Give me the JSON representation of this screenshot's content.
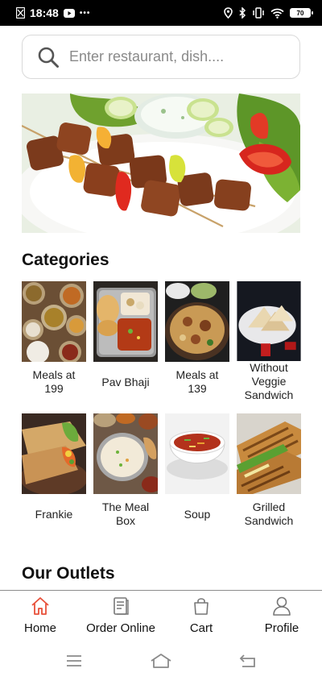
{
  "status_bar": {
    "time": "18:48",
    "dots": "•••",
    "battery": "70"
  },
  "search": {
    "placeholder": "Enter restaurant, dish....",
    "value": ""
  },
  "banner": {
    "icon": "kebab-skewers-photo"
  },
  "categories": {
    "title": "Categories",
    "items": [
      {
        "label": "Meals at 199",
        "icon": "thali-photo"
      },
      {
        "label": "Pav Bhaji",
        "icon": "pav-bhaji-photo"
      },
      {
        "label": "Meals at 139",
        "icon": "biryani-photo"
      },
      {
        "label": "Without Veggie Sandwich",
        "icon": "sandwich-photo"
      },
      {
        "label": "Frankie",
        "icon": "wrap-photo"
      },
      {
        "label": "The Meal Box",
        "icon": "meal-box-photo"
      },
      {
        "label": "Soup",
        "icon": "soup-photo"
      },
      {
        "label": "Grilled Sandwich",
        "icon": "grilled-sandwich-photo"
      }
    ]
  },
  "outlets": {
    "title": "Our Outlets"
  },
  "bottom_nav": {
    "accent": "#e8503a",
    "items": [
      {
        "label": "Home",
        "icon": "home-icon",
        "active": true
      },
      {
        "label": "Order Online",
        "icon": "menu-card-icon",
        "active": false
      },
      {
        "label": "Cart",
        "icon": "shopping-bag-icon",
        "active": false
      },
      {
        "label": "Profile",
        "icon": "user-icon",
        "active": false
      }
    ]
  }
}
